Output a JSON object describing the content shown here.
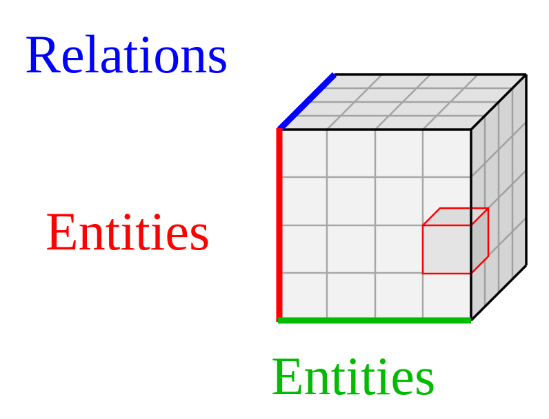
{
  "labels": {
    "relations": "Relations",
    "entities_left": "Entities",
    "entities_bottom": "Entities"
  },
  "colors": {
    "relations_axis": "#0000ff",
    "entities_axis_left": "#ff0000",
    "entities_axis_bottom": "#00bb00",
    "highlight_cell": "#ff0000",
    "front_face": "#f2f2f2",
    "top_face": "#e2e2e2",
    "side_face": "#cfcfcf",
    "grid": "#8f8f8f",
    "edge": "#000000"
  },
  "icons": {
    "tensor": "cube-icon",
    "highlight": "cell-cube-icon"
  }
}
